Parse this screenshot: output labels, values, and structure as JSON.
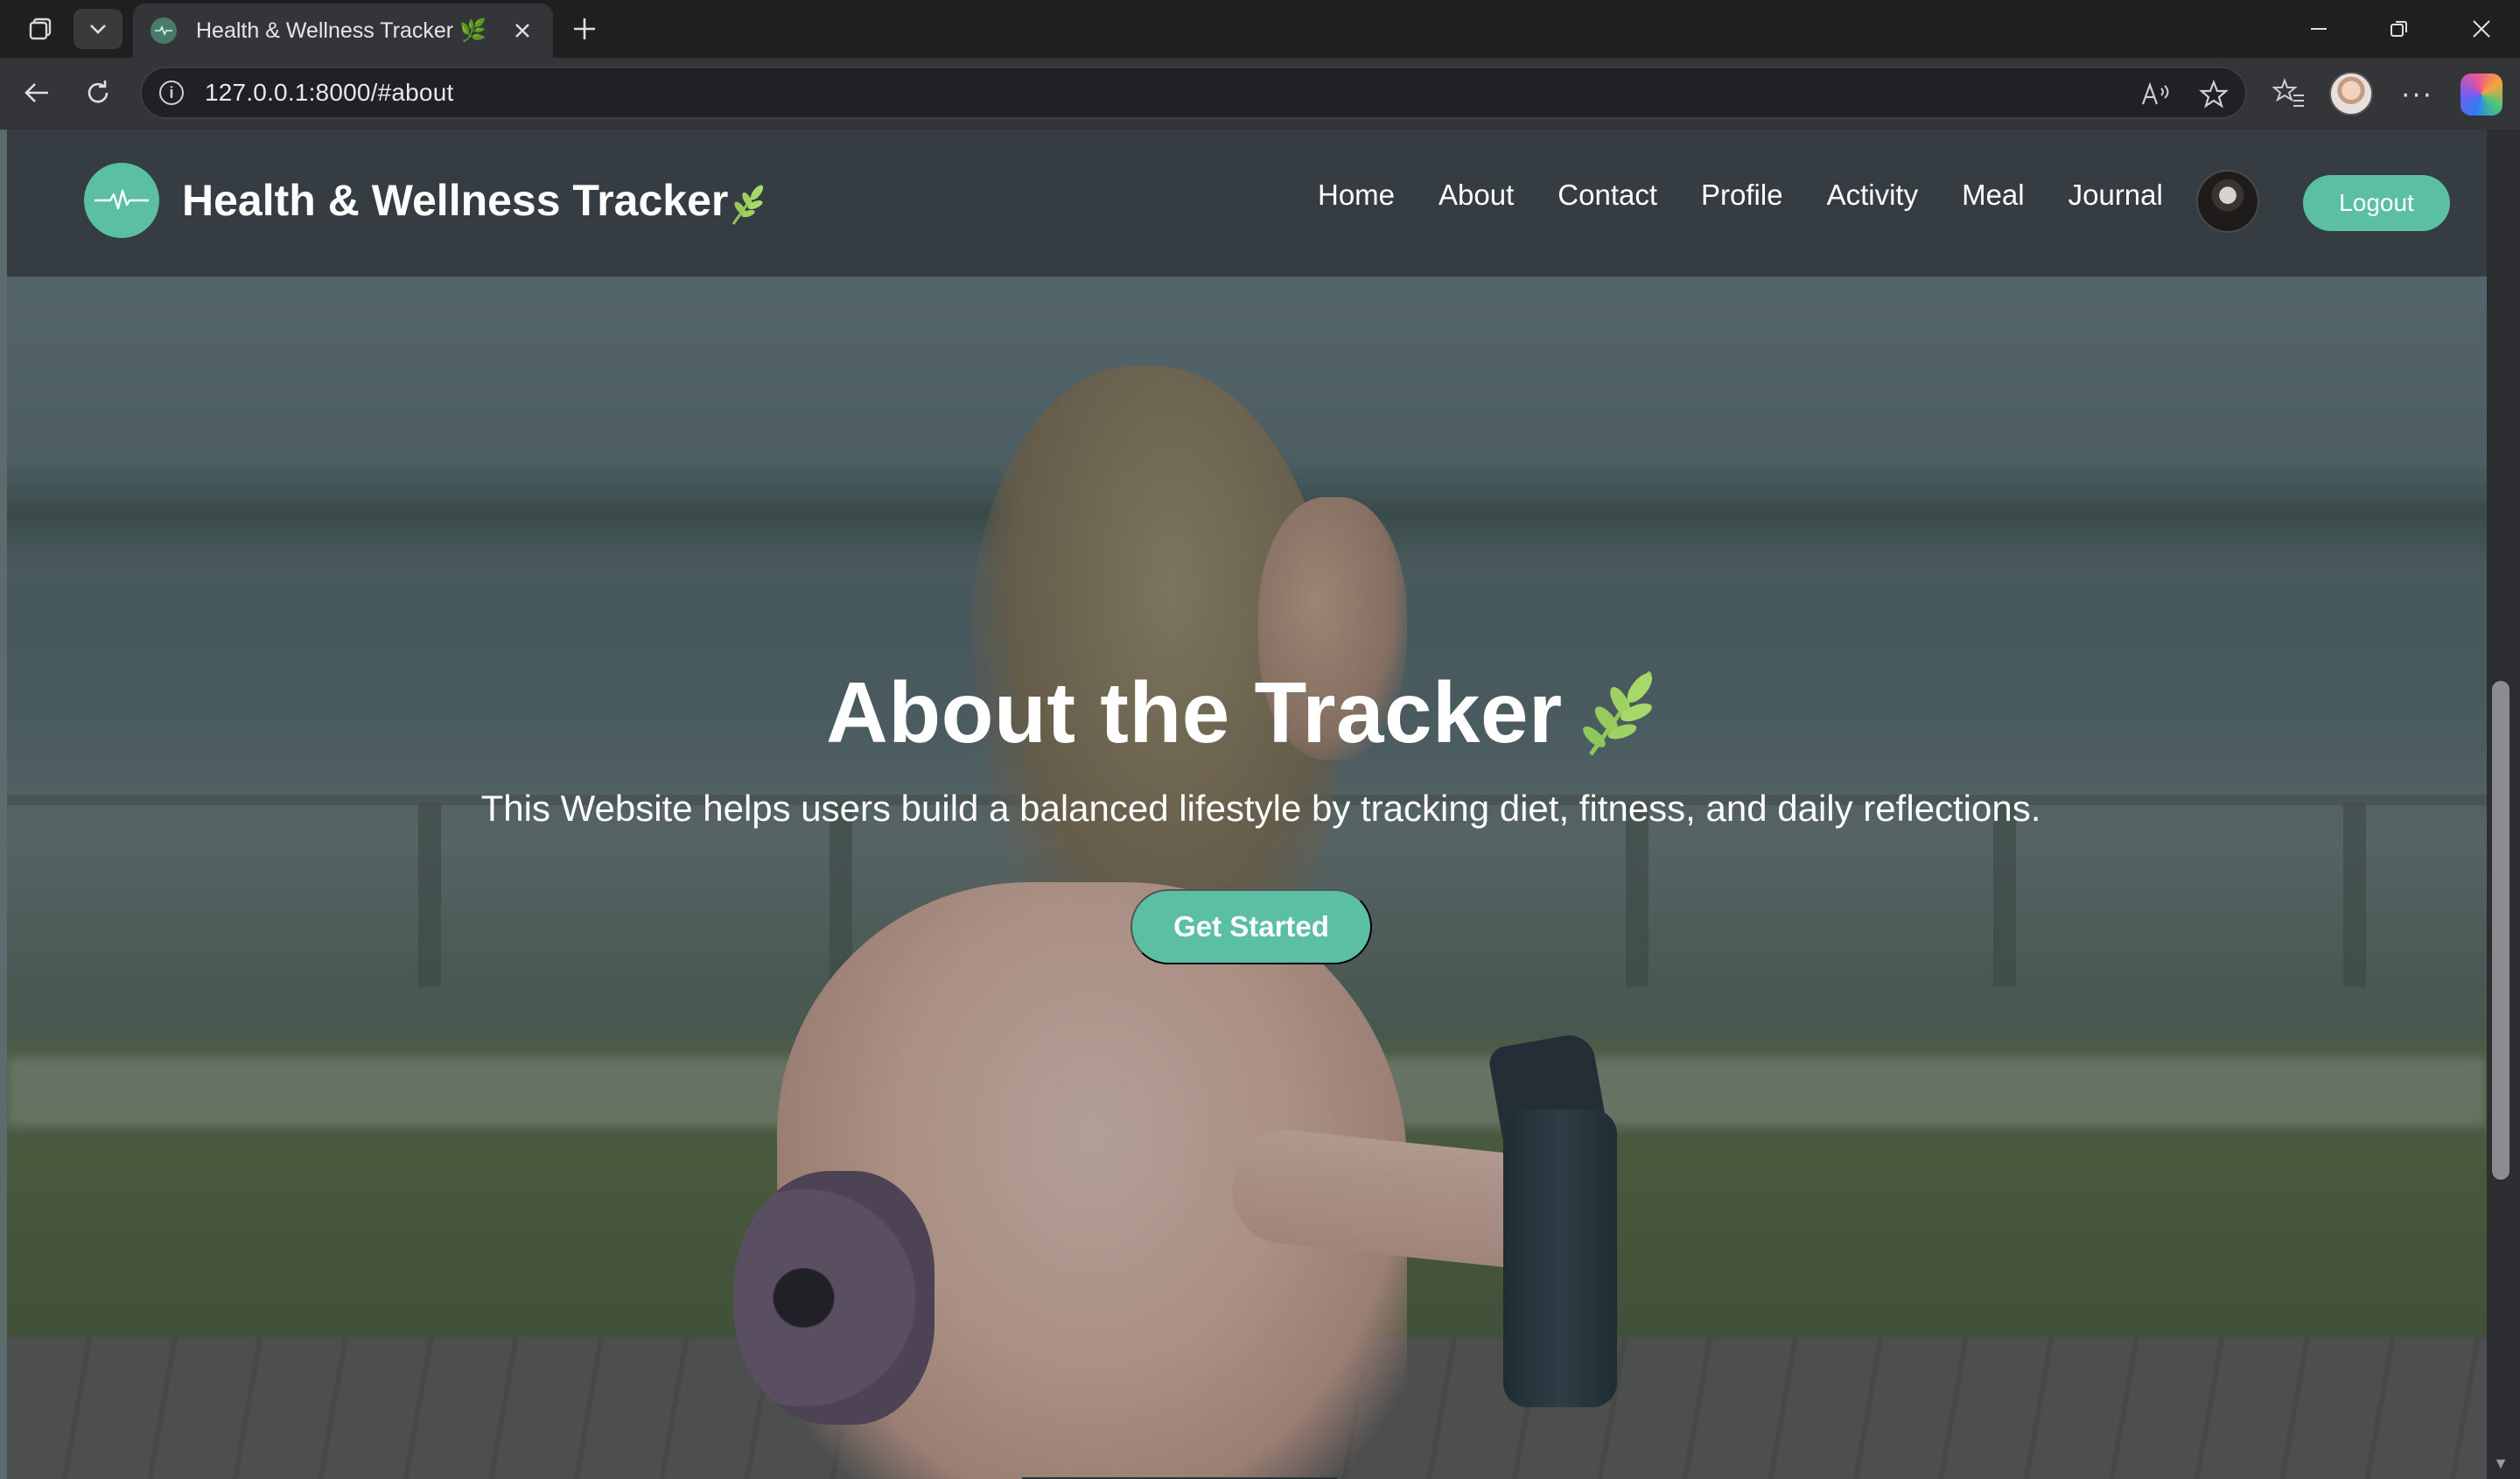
{
  "browser": {
    "tab_title": "Health & Wellness Tracker 🌿",
    "url": "127.0.0.1:8000/#about",
    "more_menu_label": "···"
  },
  "site": {
    "brand": "Health & Wellness Tracker",
    "nav": [
      "Home",
      "About",
      "Contact",
      "Profile",
      "Activity",
      "Meal",
      "Journal"
    ],
    "logout_label": "Logout"
  },
  "hero": {
    "title": "About the Tracker",
    "subtitle": "This Website helps users build a balanced lifestyle by tracking diet, fitness, and daily reflections.",
    "cta_label": "Get Started"
  },
  "colors": {
    "accent": "#5bbfa3",
    "navbar": "#353d42",
    "browser_bg": "#1f1f1f"
  },
  "icons": {
    "brand_logo": "heartbeat-icon",
    "brand_leaf": "leaf-icon",
    "hero_leaf": "leaf-icon"
  }
}
